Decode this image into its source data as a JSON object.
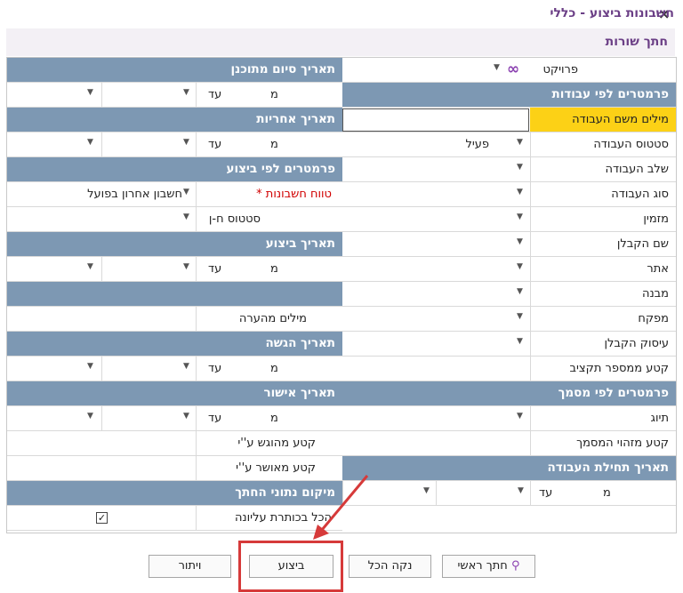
{
  "window": {
    "title": "חשבונות ביצוע - כללי",
    "close": "×"
  },
  "section_title": "חתך שורות",
  "right_column": {
    "project": {
      "label": "פרויקט",
      "icon": "∞"
    },
    "work_params_header": "פרמטרים לפי עבודות",
    "job_words": {
      "label": "מילים משם העבודה"
    },
    "job_status": {
      "label": "סטטוס העבודה",
      "value": "פעיל"
    },
    "job_stage": {
      "label": "שלב העבודה"
    },
    "job_type": {
      "label": "סוג העבודה"
    },
    "orderer": {
      "label": "מזמין"
    },
    "contractor_name": {
      "label": "שם הקבלן"
    },
    "site": {
      "label": "אתר"
    },
    "building": {
      "label": "מבנה"
    },
    "supplier": {
      "label": "מפקח"
    },
    "contractor_occupation": {
      "label": "עיסוק הקבלן"
    },
    "budget_range": {
      "label": "קטע ממספר תקציב"
    },
    "doc_params_header": "פרמטרים לפי מסמך",
    "tag": {
      "label": "תיוג"
    },
    "doc_id_range": {
      "label": "קטע מזהוי המסמך"
    },
    "job_start_header": "תאריך תחילת העבודה",
    "job_start": {
      "from": "מ",
      "to": "עד"
    }
  },
  "left_column": {
    "planned_end_header": "תאריך סיום מתוכנן",
    "planned_end": {
      "from": "מ",
      "to": "עד"
    },
    "warranty_header": "תאריך אחריות",
    "warranty": {
      "from": "מ",
      "to": "עד"
    },
    "exec_params_header": "פרמטרים לפי ביצוע",
    "account_range": {
      "label": "טווח חשבונות",
      "required": "*",
      "value": "חשבון אחרון בפועל"
    },
    "account_status": {
      "label": "סטטוס ח-ן"
    },
    "exec_date_header": "תאריך ביצוע",
    "exec_date": {
      "from": "מ",
      "to": "עד"
    },
    "remark_words": {
      "label": "מילים מהערה"
    },
    "submit_date_header": "תאריך הגשה",
    "submit_date": {
      "from": "מ",
      "to": "עד"
    },
    "approval_date_header": "תאריך אישור",
    "approval_date": {
      "from": "מ",
      "to": "עד"
    },
    "submitted_by": {
      "label": "קטע מהוגש ע''י"
    },
    "approved_by": {
      "label": "קטע מאושר ע''י"
    },
    "data_location_header": "מיקום נתוני החתך",
    "all_top_header": {
      "label": "הכל בכותרת עליונה",
      "checked": "✓"
    }
  },
  "buttons": {
    "main_cut": "חתך ראשי",
    "clear_all": "נקה הכל",
    "execute": "ביצוע",
    "cancel": "ויתור"
  },
  "colors": {
    "header_bg": "#7d98b3",
    "highlight": "#fcd116",
    "accent": "#6b3f86",
    "annotation": "#d63a3a"
  }
}
